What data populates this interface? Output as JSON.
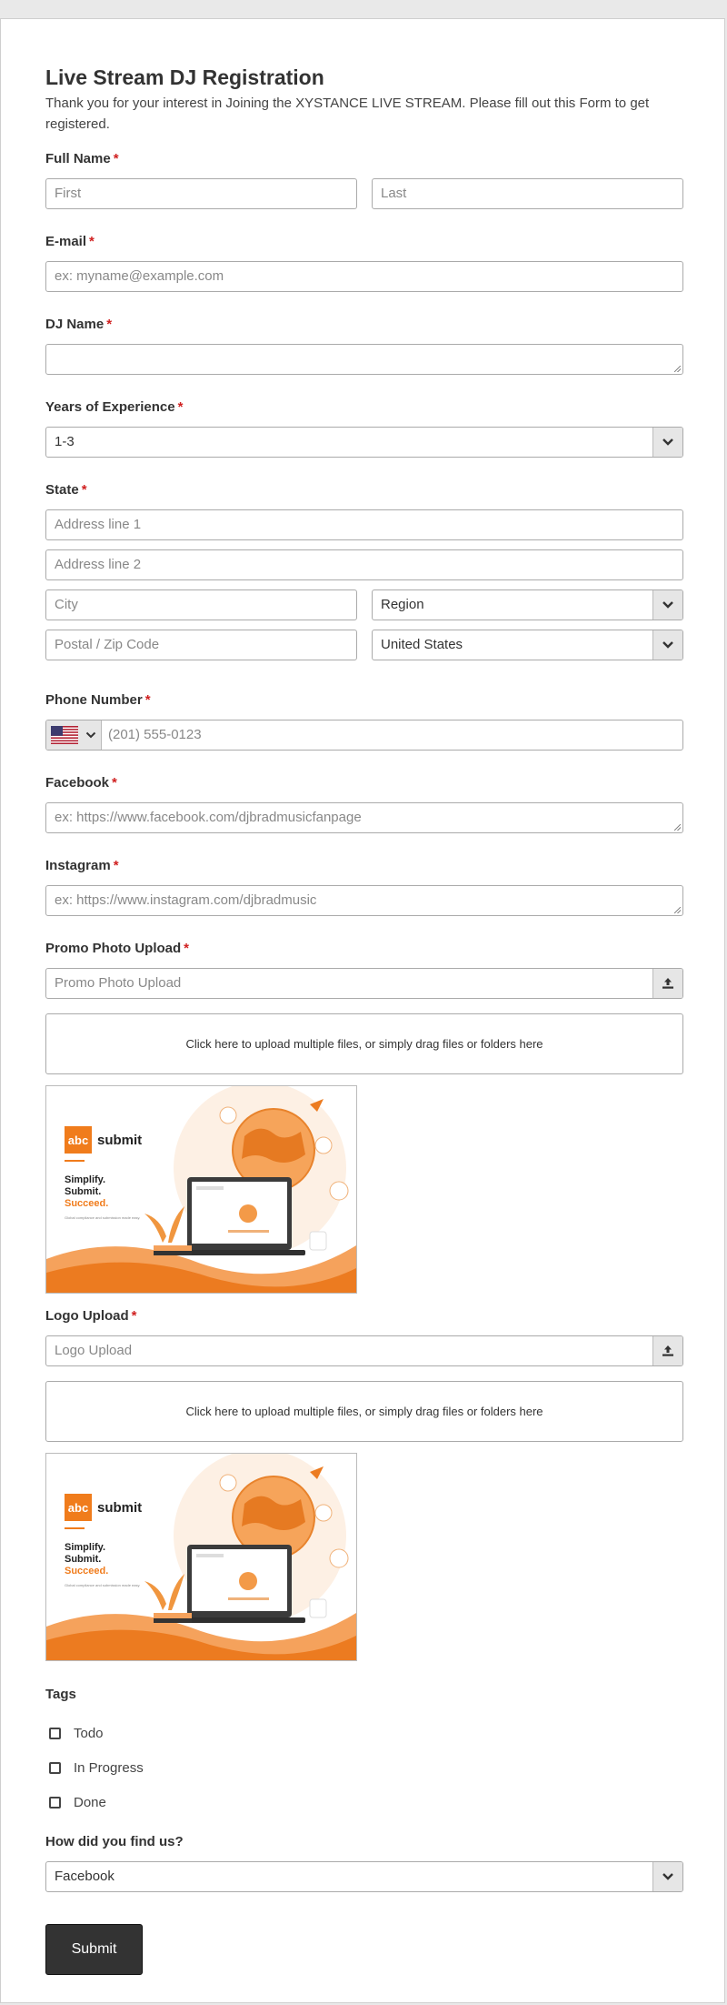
{
  "form": {
    "title": "Live Stream DJ Registration",
    "description": "Thank you for your interest in Joining the XYSTANCE LIVE STREAM. Please fill out this Form to get registered.",
    "required_marker": "*"
  },
  "full_name": {
    "label": "Full Name",
    "first_placeholder": "First",
    "last_placeholder": "Last"
  },
  "email": {
    "label": "E-mail",
    "placeholder": "ex: myname@example.com"
  },
  "dj_name": {
    "label": "DJ Name",
    "value": ""
  },
  "experience": {
    "label": "Years of Experience",
    "value": "1-3"
  },
  "state": {
    "label": "State",
    "address1_placeholder": "Address line 1",
    "address2_placeholder": "Address line 2",
    "city_placeholder": "City",
    "region_value": "Region",
    "postal_placeholder": "Postal / Zip Code",
    "country_value": "United States"
  },
  "phone": {
    "label": "Phone Number",
    "placeholder": "(201) 555-0123",
    "flag_icon": "us-flag-icon"
  },
  "facebook": {
    "label": "Facebook",
    "placeholder": "ex: https://www.facebook.com/djbradmusicfanpage"
  },
  "instagram": {
    "label": "Instagram",
    "placeholder": "ex: https://www.instagram.com/djbradmusic"
  },
  "promo_upload": {
    "label": "Promo Photo Upload",
    "placeholder": "Promo Photo Upload",
    "dropzone_text": "Click here to upload multiple files, or simply drag files or folders here"
  },
  "logo_upload": {
    "label": "Logo Upload",
    "placeholder": "Logo Upload",
    "dropzone_text": "Click here to upload multiple files, or simply drag files or folders here"
  },
  "preview_image": {
    "brand_badge": "abc",
    "brand_name": "submit",
    "line1": "Simplify.",
    "line2": "Submit.",
    "line3": "Succeed.",
    "tagline": "Global compliance and submission made easy."
  },
  "tags": {
    "label": "Tags",
    "options": [
      "Todo",
      "In Progress",
      "Done"
    ]
  },
  "source": {
    "label": "How did you find us?",
    "value": "Facebook"
  },
  "submit_label": "Submit",
  "colors": {
    "accent": "#f07c1c",
    "required": "#d02020",
    "button": "#333333"
  }
}
